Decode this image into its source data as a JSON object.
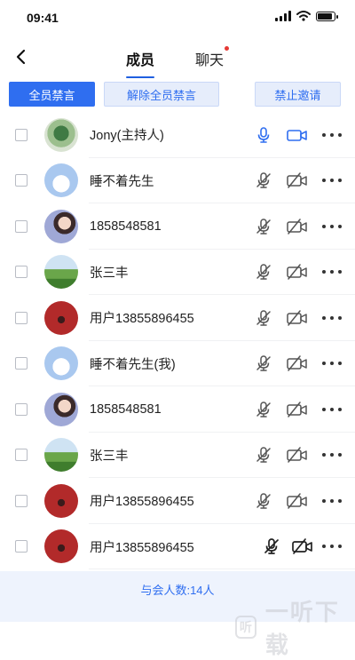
{
  "status_bar": {
    "time": "09:41"
  },
  "nav": {
    "tabs": [
      {
        "label": "成员",
        "active": true
      },
      {
        "label": "聊天",
        "has_notification_dot": true
      }
    ]
  },
  "actions": {
    "mute_all": "全员禁言",
    "unmute_all": "解除全员禁言",
    "stop_invite": "禁止邀请"
  },
  "members": [
    {
      "name": "Jony(主持人)",
      "mic": "on",
      "camera": "on"
    },
    {
      "name": "睡不着先生",
      "mic": "off",
      "camera": "off"
    },
    {
      "name": "1858548581",
      "mic": "off",
      "camera": "off"
    },
    {
      "name": "张三丰",
      "mic": "off",
      "camera": "off"
    },
    {
      "name": "用户13855896455",
      "mic": "off",
      "camera": "off"
    },
    {
      "name": "睡不着先生(我)",
      "mic": "off",
      "camera": "off"
    },
    {
      "name": "1858548581",
      "mic": "off",
      "camera": "off"
    },
    {
      "name": "张三丰",
      "mic": "off",
      "camera": "off"
    },
    {
      "name": "用户13855896455",
      "mic": "off",
      "camera": "off"
    },
    {
      "name": "用户13855896455",
      "mic": "off",
      "camera": "off"
    }
  ],
  "footer": {
    "attendee_count": "与会人数:14人"
  },
  "watermark": {
    "text": "一听下载"
  },
  "colors": {
    "accent": "#2f6ef0",
    "notification": "#e53935"
  }
}
